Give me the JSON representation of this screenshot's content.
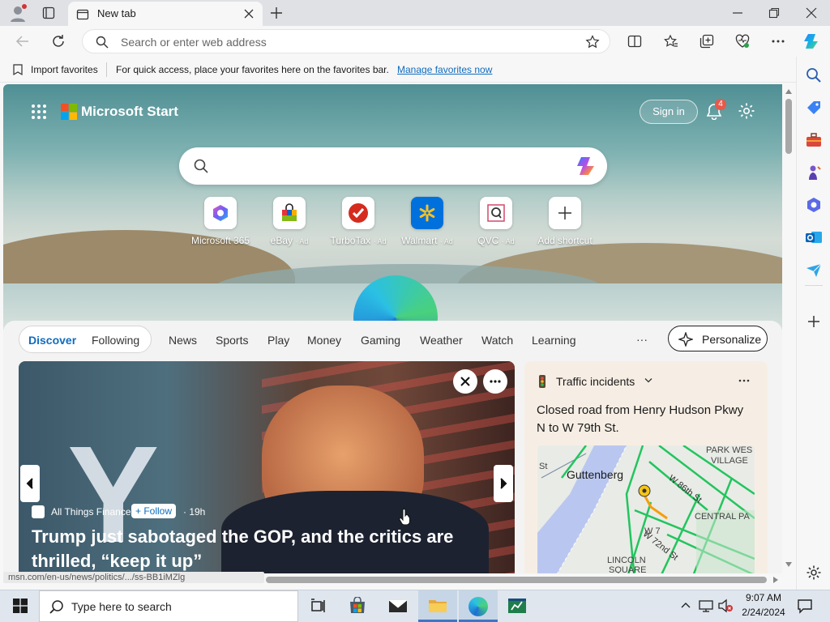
{
  "browser": {
    "tab_title": "New tab",
    "address_placeholder": "Search or enter web address"
  },
  "favorites_bar": {
    "import_label": "Import favorites",
    "hint_text": "For quick access, place your favorites here on the favorites bar.",
    "manage_link": "Manage favorites now"
  },
  "header": {
    "brand": "Microsoft Start",
    "sign_in": "Sign in",
    "notification_count": "4"
  },
  "search": {
    "placeholder": ""
  },
  "shortcuts": [
    {
      "label": "Microsoft 365",
      "ad": ""
    },
    {
      "label": "eBay",
      "ad": "· Ad"
    },
    {
      "label": "TurboTax",
      "ad": "· Ad"
    },
    {
      "label": "Walmart",
      "ad": "· Ad"
    },
    {
      "label": "QVC",
      "ad": "· Ad"
    },
    {
      "label": "Add shortcut",
      "ad": ""
    }
  ],
  "feed_nav": {
    "tabs": [
      "Discover",
      "Following",
      "News",
      "Sports",
      "Play",
      "Money",
      "Gaming",
      "Weather",
      "Watch",
      "Learning"
    ],
    "more": "···",
    "personalize": "Personalize"
  },
  "hero_card": {
    "source": "All Things Finance",
    "follow": "+ Follow",
    "age": "· 19h",
    "headline": "Trump just sabotaged the GOP, and the critics are thrilled, “keep it up”"
  },
  "traffic_card": {
    "title": "Traffic incidents",
    "body": "Closed road from Henry Hudson Pkwy N to W 79th St.",
    "map_labels": [
      "Guttenberg",
      "PARK WES",
      "VILLAGE",
      "W 86th St",
      "CENTRAL PA",
      "W 72nd St",
      "LINCOLN",
      "SQUARE",
      "St",
      "W 7"
    ]
  },
  "status_url": "msn.com/en-us/news/politics/.../ss-BB1iMZlg",
  "taskbar": {
    "search_placeholder": "Type here to search",
    "time": "9:07 AM",
    "date": "2/24/2024"
  },
  "colors": {
    "accent": "#0f6cbd",
    "map_road": "#22c55e",
    "incident": "#f59e0b"
  }
}
